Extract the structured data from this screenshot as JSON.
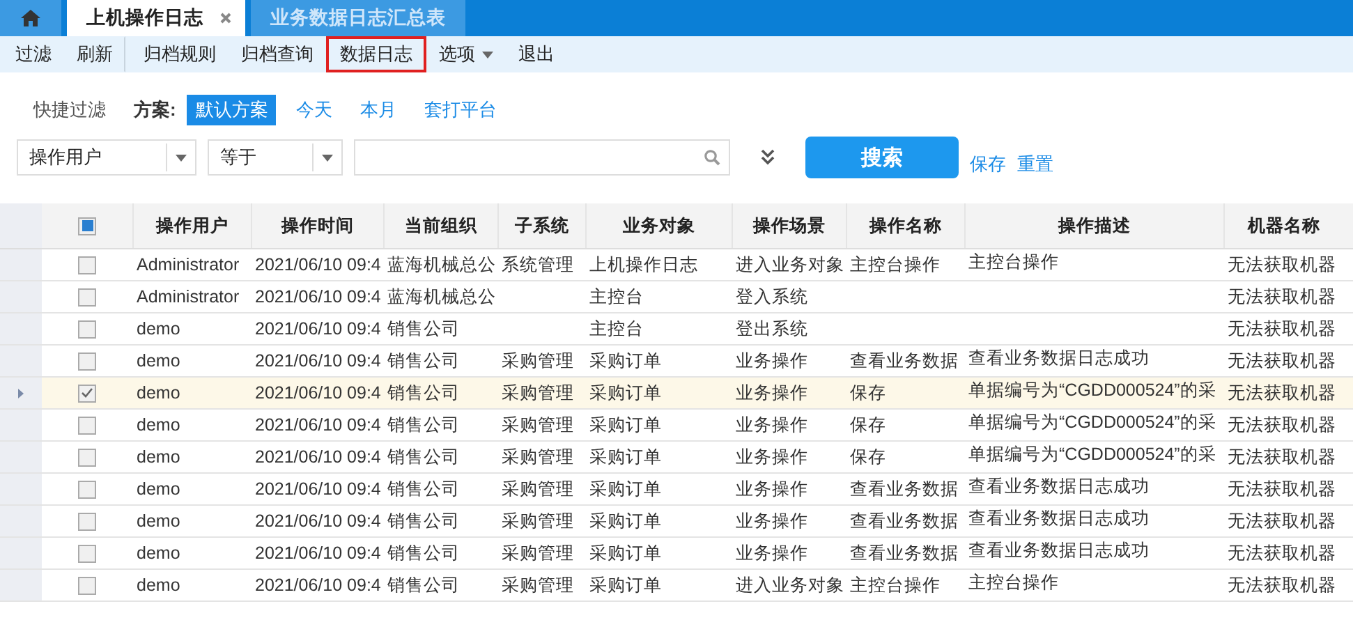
{
  "tabs": [
    {
      "label": "上机操作日志",
      "selected": true,
      "closable": true
    },
    {
      "label": "业务数据日志汇总表",
      "selected": false,
      "closable": false
    }
  ],
  "toolbar": [
    {
      "label": "过滤",
      "highlighted": false,
      "dropdown": false,
      "divider_after": false
    },
    {
      "label": "刷新",
      "highlighted": false,
      "dropdown": false,
      "divider_after": true
    },
    {
      "label": "归档规则",
      "highlighted": false,
      "dropdown": false,
      "divider_after": false
    },
    {
      "label": "归档查询",
      "highlighted": false,
      "dropdown": false,
      "divider_after": false
    },
    {
      "label": "数据日志",
      "highlighted": true,
      "dropdown": false,
      "divider_after": false
    },
    {
      "label": "选项",
      "highlighted": false,
      "dropdown": true,
      "divider_after": false
    },
    {
      "label": "退出",
      "highlighted": false,
      "dropdown": false,
      "divider_after": false
    }
  ],
  "quick_filter": {
    "label": "快捷过滤",
    "scheme_label": "方案:",
    "schemes": [
      {
        "label": "默认方案",
        "selected": true
      },
      {
        "label": "今天",
        "selected": false
      },
      {
        "label": "本月",
        "selected": false
      },
      {
        "label": "套打平台",
        "selected": false
      }
    ]
  },
  "filter": {
    "field": "操作用户",
    "operator": "等于",
    "search_button": "搜索",
    "links": [
      "保存",
      "重置"
    ]
  },
  "table": {
    "columns": [
      "操作用户",
      "操作时间",
      "当前组织",
      "子系统",
      "业务对象",
      "操作场景",
      "操作名称",
      "操作描述",
      "机器名称"
    ],
    "header_checkbox_partial": true,
    "rows": [
      {
        "selected": false,
        "checked": false,
        "cells": [
          "Administrator",
          "2021/06/10 09:4",
          "蓝海机械总公",
          "系统管理",
          "上机操作日志",
          "进入业务对象",
          "主控台操作",
          "主控台操作",
          "无法获取机器"
        ]
      },
      {
        "selected": false,
        "checked": false,
        "cells": [
          "Administrator",
          "2021/06/10 09:4",
          "蓝海机械总公",
          "",
          "主控台",
          "登入系统",
          "",
          "",
          "无法获取机器"
        ]
      },
      {
        "selected": false,
        "checked": false,
        "cells": [
          "demo",
          "2021/06/10 09:4",
          "销售公司",
          "",
          "主控台",
          "登出系统",
          "",
          "",
          "无法获取机器"
        ]
      },
      {
        "selected": false,
        "checked": false,
        "cells": [
          "demo",
          "2021/06/10 09:4",
          "销售公司",
          "采购管理",
          "采购订单",
          "业务操作",
          "查看业务数据",
          "查看业务数据日志成功",
          "无法获取机器"
        ]
      },
      {
        "selected": true,
        "checked": true,
        "cells": [
          "demo",
          "2021/06/10 09:4",
          "销售公司",
          "采购管理",
          "采购订单",
          "业务操作",
          "保存",
          "单据编号为“CGDD000524”的采",
          "无法获取机器"
        ]
      },
      {
        "selected": false,
        "checked": false,
        "cells": [
          "demo",
          "2021/06/10 09:4",
          "销售公司",
          "采购管理",
          "采购订单",
          "业务操作",
          "保存",
          "单据编号为“CGDD000524”的采",
          "无法获取机器"
        ]
      },
      {
        "selected": false,
        "checked": false,
        "cells": [
          "demo",
          "2021/06/10 09:4",
          "销售公司",
          "采购管理",
          "采购订单",
          "业务操作",
          "保存",
          "单据编号为“CGDD000524”的采",
          "无法获取机器"
        ]
      },
      {
        "selected": false,
        "checked": false,
        "cells": [
          "demo",
          "2021/06/10 09:4",
          "销售公司",
          "采购管理",
          "采购订单",
          "业务操作",
          "查看业务数据",
          "查看业务数据日志成功",
          "无法获取机器"
        ]
      },
      {
        "selected": false,
        "checked": false,
        "cells": [
          "demo",
          "2021/06/10 09:4",
          "销售公司",
          "采购管理",
          "采购订单",
          "业务操作",
          "查看业务数据",
          "查看业务数据日志成功",
          "无法获取机器"
        ]
      },
      {
        "selected": false,
        "checked": false,
        "cells": [
          "demo",
          "2021/06/10 09:4",
          "销售公司",
          "采购管理",
          "采购订单",
          "业务操作",
          "查看业务数据",
          "查看业务数据日志成功",
          "无法获取机器"
        ]
      },
      {
        "selected": false,
        "checked": false,
        "cells": [
          "demo",
          "2021/06/10 09:4",
          "销售公司",
          "采购管理",
          "采购订单",
          "进入业务对象",
          "主控台操作",
          "主控台操作",
          "无法获取机器"
        ]
      }
    ]
  }
}
